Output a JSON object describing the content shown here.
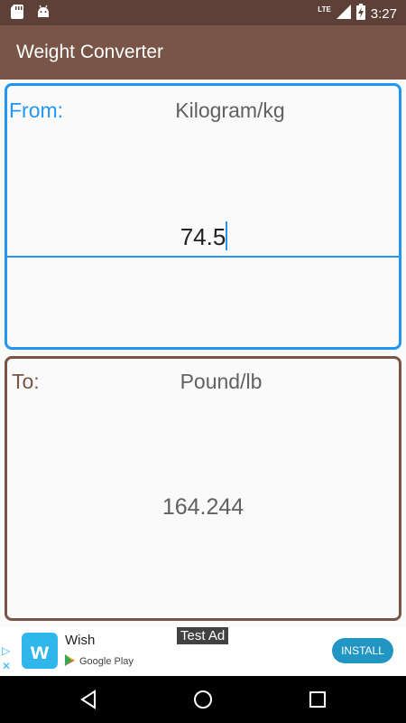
{
  "status_bar": {
    "time": "3:27",
    "network": "LTE",
    "icons": [
      "sd-card-icon",
      "android-icon",
      "signal-icon",
      "battery-charging-icon"
    ]
  },
  "app_bar": {
    "title": "Weight Converter"
  },
  "converter": {
    "from": {
      "label": "From:",
      "unit": "Kilogram/kg",
      "value": "74.5"
    },
    "to": {
      "label": "To:",
      "unit": "Pound/lb",
      "value": "164.244"
    }
  },
  "ad": {
    "app_name": "Wish",
    "store": "Google Play",
    "test_label": "Test Ad",
    "install_label": "INSTALL",
    "logo_letter": "w"
  },
  "colors": {
    "status_bar": "#5d4037",
    "app_bar": "#795548",
    "accent": "#2196f3",
    "card_to_border": "#795548"
  }
}
